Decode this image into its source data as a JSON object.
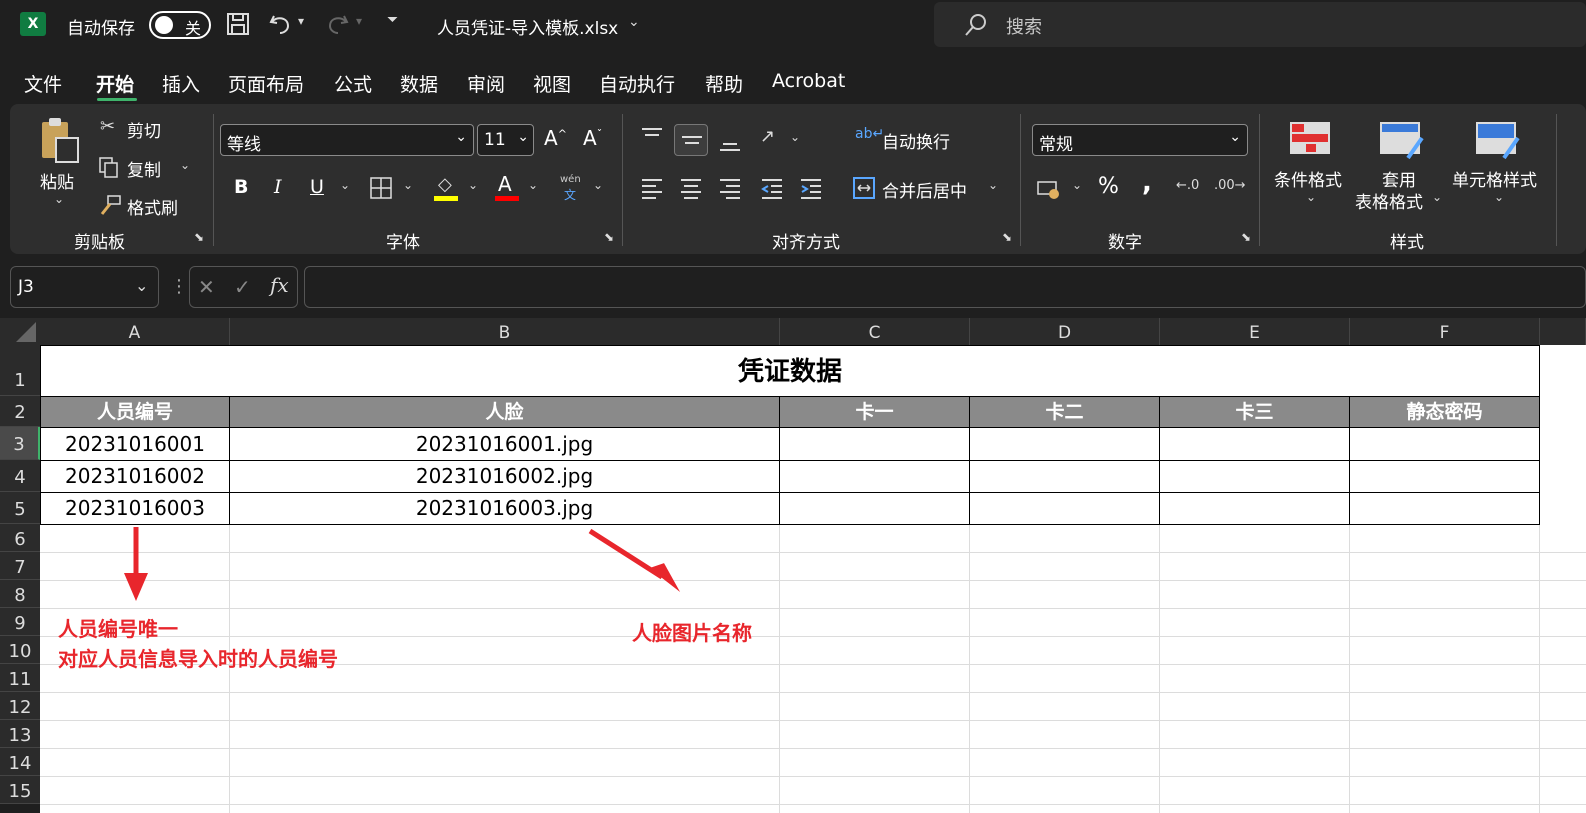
{
  "titlebar": {
    "logo": "X",
    "autosave_label": "自动保存",
    "toggle_label": "关",
    "filename": "人员凭证-导入模板.xlsx",
    "search_placeholder": "搜索"
  },
  "menu": [
    "文件",
    "开始",
    "插入",
    "页面布局",
    "公式",
    "数据",
    "审阅",
    "视图",
    "自动执行",
    "帮助",
    "Acrobat"
  ],
  "ribbon": {
    "clipboard": {
      "paste": "粘贴",
      "cut": "剪切",
      "copy": "复制",
      "format_painter": "格式刷",
      "group": "剪贴板"
    },
    "font": {
      "name": "等线",
      "size": "11",
      "bold": "B",
      "italic": "I",
      "underline": "U",
      "group": "字体",
      "font_color_letter": "A",
      "highlight_color": "#ffff00",
      "font_color": "#ff0000",
      "wen": "wén",
      "wen2": "文"
    },
    "alignment": {
      "wrap": "自动换行",
      "merge": "合并后居中",
      "group": "对齐方式"
    },
    "number": {
      "format": "常规",
      "percent": "%",
      "comma": ",",
      "group": "数字"
    },
    "styles": {
      "conditional": "条件格式",
      "table1": "套用",
      "table2": "表格格式",
      "cell": "单元格样式",
      "group": "样式"
    }
  },
  "formula_bar": {
    "name_box": "J3",
    "fx": "fx",
    "cancel": "✕",
    "enter": "✓",
    "formula": ""
  },
  "columns": [
    "A",
    "B",
    "C",
    "D",
    "E",
    "F"
  ],
  "rows": [
    "1",
    "2",
    "3",
    "4",
    "5",
    "6",
    "7",
    "8",
    "9",
    "10",
    "11",
    "12",
    "13",
    "14",
    "15"
  ],
  "sheet": {
    "title": "凭证数据",
    "headers": [
      "人员编号",
      "人脸",
      "卡一",
      "卡二",
      "卡三",
      "静态密码"
    ],
    "data": [
      [
        "20231016001",
        "20231016001.jpg",
        "",
        "",
        "",
        ""
      ],
      [
        "20231016002",
        "20231016002.jpg",
        "",
        "",
        "",
        ""
      ],
      [
        "20231016003",
        "20231016003.jpg",
        "",
        "",
        "",
        ""
      ]
    ]
  },
  "annotations": {
    "left_line1": "人员编号唯一",
    "left_line2": "对应人员信息导入时的人员编号",
    "right": "人脸图片名称",
    "color": "#e8262c"
  }
}
